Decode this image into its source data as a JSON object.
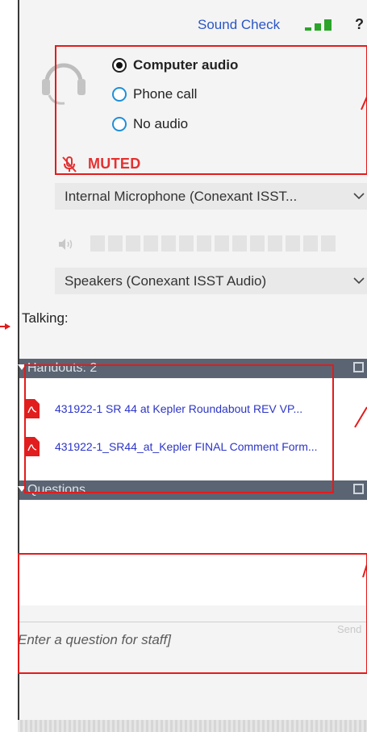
{
  "header": {
    "sound_check_label": "Sound Check",
    "signal_icon": "signal-bars-icon",
    "help_label": "?"
  },
  "audio": {
    "options": [
      {
        "label": "Computer audio",
        "selected": true
      },
      {
        "label": "Phone call",
        "selected": false
      },
      {
        "label": "No audio",
        "selected": false
      }
    ],
    "status": "MUTED",
    "microphone": "Internal Microphone (Conexant ISST...",
    "speakers": "Speakers (Conexant ISST Audio)",
    "talking_label": "Talking:"
  },
  "handouts": {
    "header": "Handouts: 2",
    "items": [
      "431922-1 SR 44 at Kepler Roundabout REV VP...",
      "431922-1_SR44_at_Kepler FINAL Comment Form..."
    ]
  },
  "questions": {
    "header": "Questions",
    "placeholder": "Enter a question for staff]",
    "send_label": "Send"
  },
  "colors": {
    "accent_blue": "#2a56c6",
    "signal_green": "#2aa52a",
    "muted_red": "#e53030",
    "panel_header": "#5b6472",
    "annotation_red": "#e31b1b"
  }
}
